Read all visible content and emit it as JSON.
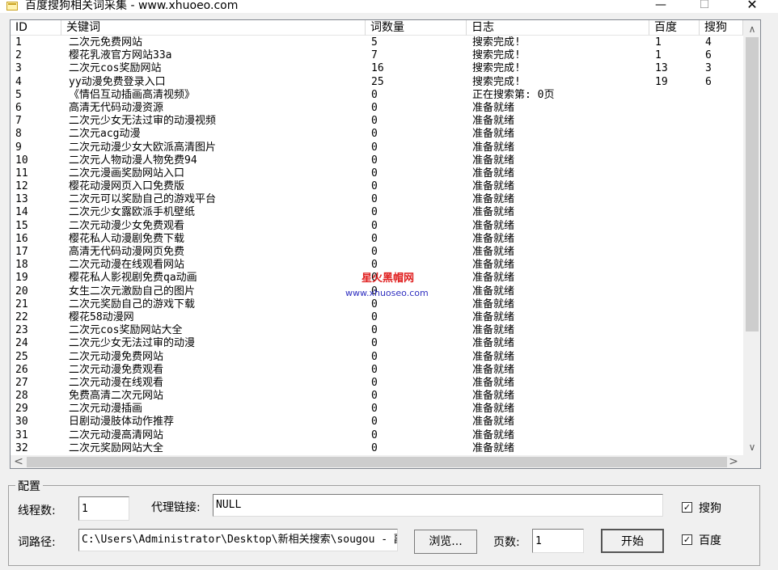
{
  "window": {
    "title": "百度搜狗相关词采集 - www.xhuoeo.com",
    "minimize": "—",
    "maximize": "☐",
    "close": "✕"
  },
  "list": {
    "columns": {
      "id": "ID",
      "keyword": "关键词",
      "count": "词数量",
      "log": "日志",
      "baidu": "百度",
      "sogou": "搜狗"
    },
    "rows": [
      {
        "id": "1",
        "kw": "二次元免费网站",
        "cnt": "5",
        "log": "搜索完成!",
        "bd": "1",
        "sg": "4"
      },
      {
        "id": "2",
        "kw": "樱花乳液官方网站33a",
        "cnt": "7",
        "log": "搜索完成!",
        "bd": "1",
        "sg": "6"
      },
      {
        "id": "3",
        "kw": "二次元cos奖励网站",
        "cnt": "16",
        "log": "搜索完成!",
        "bd": "13",
        "sg": "3"
      },
      {
        "id": "4",
        "kw": "yy动漫免费登录入口",
        "cnt": "25",
        "log": "搜索完成!",
        "bd": "19",
        "sg": "6"
      },
      {
        "id": "5",
        "kw": "《情侣互动插画高清视频》",
        "cnt": "0",
        "log": "正在搜索第: 0页",
        "bd": "",
        "sg": ""
      },
      {
        "id": "6",
        "kw": "高清无代码动漫资源",
        "cnt": "0",
        "log": "准备就绪",
        "bd": "",
        "sg": ""
      },
      {
        "id": "7",
        "kw": "二次元少女无法过审的动漫视频",
        "cnt": "0",
        "log": "准备就绪",
        "bd": "",
        "sg": ""
      },
      {
        "id": "8",
        "kw": "二次元acg动漫",
        "cnt": "0",
        "log": "准备就绪",
        "bd": "",
        "sg": ""
      },
      {
        "id": "9",
        "kw": "二次元动漫少女大欧派高清图片",
        "cnt": "0",
        "log": "准备就绪",
        "bd": "",
        "sg": ""
      },
      {
        "id": "10",
        "kw": "二次元人物动漫人物免费94",
        "cnt": "0",
        "log": "准备就绪",
        "bd": "",
        "sg": ""
      },
      {
        "id": "11",
        "kw": "二次元漫画奖励网站入口",
        "cnt": "0",
        "log": "准备就绪",
        "bd": "",
        "sg": ""
      },
      {
        "id": "12",
        "kw": "樱花动漫网页入口免费版",
        "cnt": "0",
        "log": "准备就绪",
        "bd": "",
        "sg": ""
      },
      {
        "id": "13",
        "kw": "二次元可以奖励自己的游戏平台",
        "cnt": "0",
        "log": "准备就绪",
        "bd": "",
        "sg": ""
      },
      {
        "id": "14",
        "kw": "二次元少女露欧派手机壁纸",
        "cnt": "0",
        "log": "准备就绪",
        "bd": "",
        "sg": ""
      },
      {
        "id": "15",
        "kw": "二次元动漫少女免费观看",
        "cnt": "0",
        "log": "准备就绪",
        "bd": "",
        "sg": ""
      },
      {
        "id": "16",
        "kw": "樱花私人动漫剧免费下载",
        "cnt": "0",
        "log": "准备就绪",
        "bd": "",
        "sg": ""
      },
      {
        "id": "17",
        "kw": "高清无代码动漫网页免费",
        "cnt": "0",
        "log": "准备就绪",
        "bd": "",
        "sg": ""
      },
      {
        "id": "18",
        "kw": "二次元动漫在线观看网站",
        "cnt": "0",
        "log": "准备就绪",
        "bd": "",
        "sg": ""
      },
      {
        "id": "19",
        "kw": "樱花私人影视剧免费qa动画",
        "cnt": "0",
        "log": "准备就绪",
        "bd": "",
        "sg": ""
      },
      {
        "id": "20",
        "kw": "女生二次元激励自己的图片",
        "cnt": "0",
        "log": "准备就绪",
        "bd": "",
        "sg": ""
      },
      {
        "id": "21",
        "kw": "二次元奖励自己的游戏下载",
        "cnt": "0",
        "log": "准备就绪",
        "bd": "",
        "sg": ""
      },
      {
        "id": "22",
        "kw": "樱花58动漫网",
        "cnt": "0",
        "log": "准备就绪",
        "bd": "",
        "sg": ""
      },
      {
        "id": "23",
        "kw": "二次元cos奖励网站大全",
        "cnt": "0",
        "log": "准备就绪",
        "bd": "",
        "sg": ""
      },
      {
        "id": "24",
        "kw": "二次元少女无法过审的动漫",
        "cnt": "0",
        "log": "准备就绪",
        "bd": "",
        "sg": ""
      },
      {
        "id": "25",
        "kw": "二次元动漫免费网站",
        "cnt": "0",
        "log": "准备就绪",
        "bd": "",
        "sg": ""
      },
      {
        "id": "26",
        "kw": "二次元动漫免费观看",
        "cnt": "0",
        "log": "准备就绪",
        "bd": "",
        "sg": ""
      },
      {
        "id": "27",
        "kw": "二次元动漫在线观看",
        "cnt": "0",
        "log": "准备就绪",
        "bd": "",
        "sg": ""
      },
      {
        "id": "28",
        "kw": "免费高清二次元网站",
        "cnt": "0",
        "log": "准备就绪",
        "bd": "",
        "sg": ""
      },
      {
        "id": "29",
        "kw": "二次元动漫插画",
        "cnt": "0",
        "log": "准备就绪",
        "bd": "",
        "sg": ""
      },
      {
        "id": "30",
        "kw": "日剧动漫肢体动作推荐",
        "cnt": "0",
        "log": "准备就绪",
        "bd": "",
        "sg": ""
      },
      {
        "id": "31",
        "kw": "二次元动漫高清网站",
        "cnt": "0",
        "log": "准备就绪",
        "bd": "",
        "sg": ""
      },
      {
        "id": "32",
        "kw": "二次元奖励网站大全",
        "cnt": "0",
        "log": "准备就绪",
        "bd": "",
        "sg": ""
      }
    ],
    "scroll_up": "∧",
    "scroll_down": "∨",
    "scroll_left": "<",
    "scroll_right": ">"
  },
  "watermark": {
    "name": "星火黑帽网",
    "url": "www.xhuoseo.com"
  },
  "config": {
    "title": "配置",
    "threads_label": "线程数:",
    "threads_value": "1",
    "proxy_label": "代理链接:",
    "proxy_value": "NULL",
    "sogou_label": "搜狗",
    "sogou_checked": "✓",
    "path_label": "词路径:",
    "path_value": "C:\\Users\\Administrator\\Desktop\\新相关搜索\\sougou - 副",
    "browse_label": "浏览...",
    "pages_label": "页数:",
    "pages_value": "1",
    "start_label": "开始",
    "baidu_label": "百度",
    "baidu_checked": "✓"
  }
}
